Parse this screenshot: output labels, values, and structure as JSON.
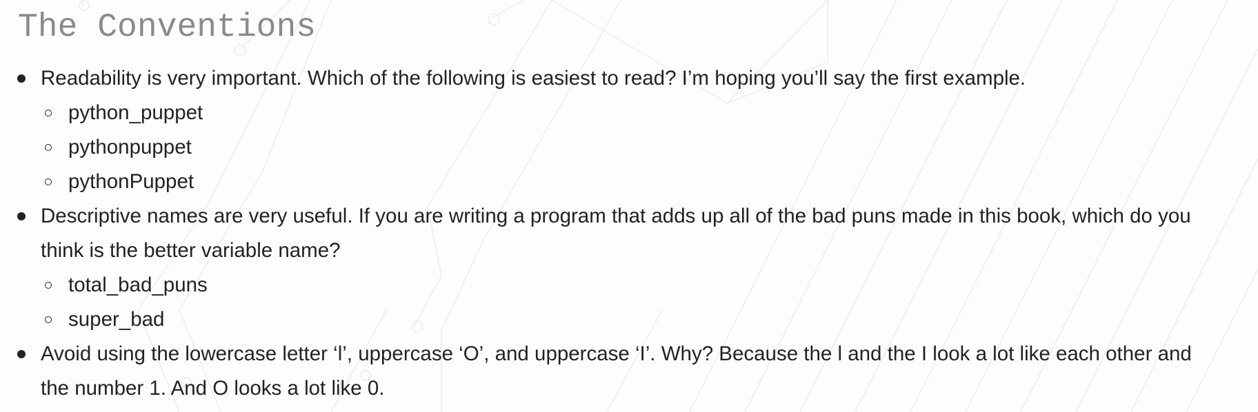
{
  "heading": "The Conventions",
  "items": [
    {
      "text": "Readability is very important. Which of the following is easiest to read? I’m hoping you’ll say the first example.",
      "sub": [
        "python_puppet",
        "pythonpuppet",
        "pythonPuppet"
      ]
    },
    {
      "text": "Descriptive names are very useful. If you are writing a program that adds up all of the bad puns made in this book, which do you think is the better variable name?",
      "sub": [
        "total_bad_puns",
        "super_bad"
      ]
    },
    {
      "text": "Avoid using the lowercase letter ‘l’, uppercase ‘O’, and uppercase ‘I’. Why? Because the l and the I look a lot like each other and the number 1. And O looks a lot like 0.",
      "sub": []
    }
  ]
}
